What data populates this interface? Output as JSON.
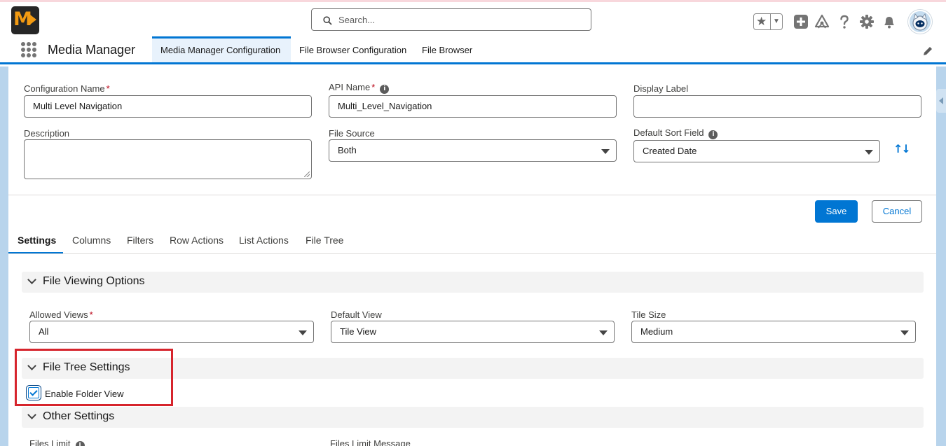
{
  "header": {
    "logo_text": "M",
    "search_placeholder": "Search..."
  },
  "nav": {
    "app_name": "Media Manager",
    "tabs": [
      {
        "label": "Media Manager Configuration",
        "active": true
      },
      {
        "label": "File Browser Configuration",
        "active": false
      },
      {
        "label": "File Browser",
        "active": false
      }
    ]
  },
  "form": {
    "config_name": {
      "label": "Configuration Name",
      "required": "*",
      "value": "Multi Level Navigation"
    },
    "api_name": {
      "label": "API Name",
      "required": "*",
      "value": "Multi_Level_Navigation"
    },
    "display_label": {
      "label": "Display Label",
      "value": ""
    },
    "description": {
      "label": "Description",
      "value": ""
    },
    "file_source": {
      "label": "File Source",
      "value": "Both"
    },
    "default_sort_field": {
      "label": "Default Sort Field",
      "value": "Created Date"
    }
  },
  "buttons": {
    "save": "Save",
    "cancel": "Cancel"
  },
  "settings_tabs": [
    {
      "label": "Settings",
      "active": true
    },
    {
      "label": "Columns",
      "active": false
    },
    {
      "label": "Filters",
      "active": false
    },
    {
      "label": "Row Actions",
      "active": false
    },
    {
      "label": "List Actions",
      "active": false
    },
    {
      "label": "File Tree",
      "active": false
    }
  ],
  "sections": {
    "file_viewing": {
      "title": "File Viewing Options",
      "allowed_views": {
        "label": "Allowed Views",
        "required": "*",
        "value": "All"
      },
      "default_view": {
        "label": "Default View",
        "value": "Tile View"
      },
      "tile_size": {
        "label": "Tile Size",
        "value": "Medium"
      }
    },
    "file_tree": {
      "title": "File Tree Settings",
      "enable_folder_view": {
        "label": "Enable Folder View",
        "checked": true
      }
    },
    "other": {
      "title": "Other Settings",
      "files_limit_label": "Files Limit",
      "files_limit_message_label": "Files Limit Message"
    }
  },
  "colors": {
    "brand": "#0176d3",
    "highlight": "#d6242c",
    "logo_orange": "#f29a12"
  }
}
